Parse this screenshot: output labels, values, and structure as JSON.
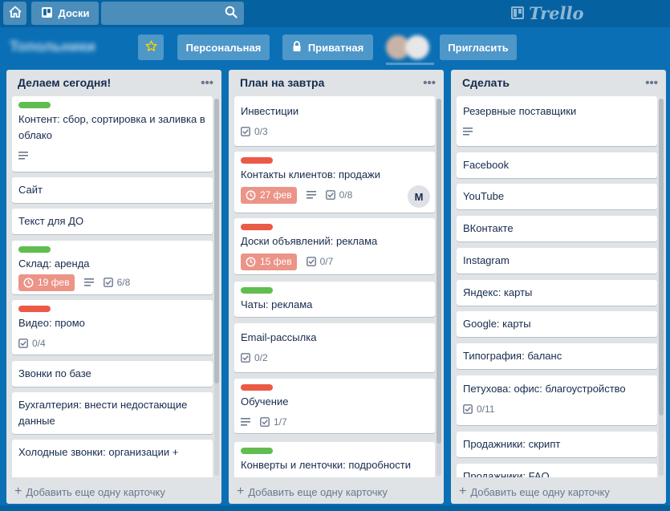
{
  "header": {
    "boards_label": "Доски",
    "logo_text": "Trello"
  },
  "board": {
    "title": "Топольники",
    "personal_label": "Персональная",
    "private_label": "Приватная",
    "invite_label": "Пригласить"
  },
  "colors": {
    "green_label": "#61bd4f",
    "red_label": "#eb5a46",
    "due_badge": "#ec9488",
    "board_bg": "#0a6fb5"
  },
  "add_card_label": "Добавить еще одну карточку",
  "lists": [
    {
      "title": "Делаем сегодня!",
      "cards": [
        {
          "title": "Контент: сбор, сортировка и заливка в облако",
          "label": "green",
          "description": true
        },
        {
          "title": "Сайт"
        },
        {
          "title": "Текст для ДО"
        },
        {
          "title": "Склад: аренда",
          "label": "green",
          "due": "19 фев",
          "description": true,
          "checklist": "6/8"
        },
        {
          "title": "Видео: промо",
          "label": "red",
          "checklist": "0/4"
        },
        {
          "title": "Звонки по базе"
        },
        {
          "title": "Бухгалтерия: внести недостающие данные"
        },
        {
          "title": "Холодные звонки: организации +"
        }
      ]
    },
    {
      "title": "План на завтра",
      "cards": [
        {
          "title": "Инвестиции",
          "checklist": "0/3"
        },
        {
          "title": "Контакты клиентов: продажи",
          "label": "red",
          "due": "27 фев",
          "description": true,
          "checklist": "0/8",
          "member": "M"
        },
        {
          "title": "Доски объявлений: реклама",
          "label": "red",
          "due": "15 фев",
          "checklist": "0/7"
        },
        {
          "title": "Чаты: реклама",
          "label": "green"
        },
        {
          "title": "Email-рассылка",
          "checklist": "0/2"
        },
        {
          "title": "Обучение",
          "label": "red",
          "description": true,
          "checklist": "1/7"
        },
        {
          "title": "Конверты и ленточки: подробности",
          "label": "green"
        }
      ]
    },
    {
      "title": "Сделать",
      "cards": [
        {
          "title": "Резервные поставщики",
          "description": true
        },
        {
          "title": "Facebook"
        },
        {
          "title": "YouTube"
        },
        {
          "title": "ВКонтакте"
        },
        {
          "title": "Instagram"
        },
        {
          "title": "Яндекс: карты"
        },
        {
          "title": "Google: карты"
        },
        {
          "title": "Типография: баланс"
        },
        {
          "title": "Петухова: офис: благоустройство",
          "checklist": "0/11"
        },
        {
          "title": "Продажники: скрипт"
        },
        {
          "title": "Продажники: FAQ"
        }
      ]
    }
  ]
}
